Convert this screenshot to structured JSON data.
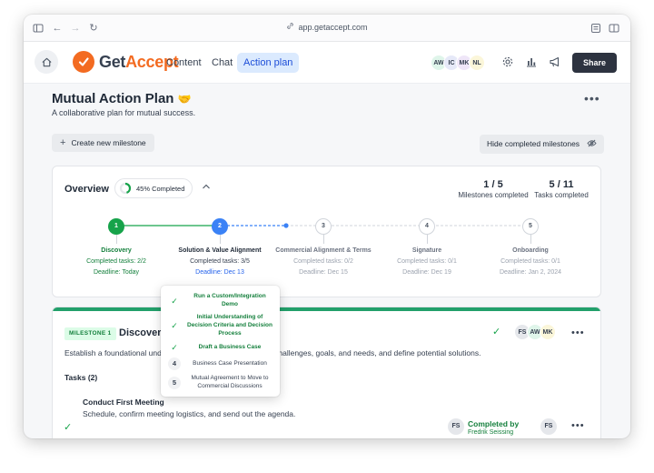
{
  "browser": {
    "url": "app.getaccept.com"
  },
  "app": {
    "logo_prefix": "Get",
    "logo_suffix": "Accept",
    "nav": [
      {
        "label": "Content",
        "active": false
      },
      {
        "label": "Chat",
        "active": false
      },
      {
        "label": "Action plan",
        "active": true
      }
    ],
    "avatars": [
      {
        "initials": "AW",
        "color": "#dff5ea"
      },
      {
        "initials": "IC",
        "color": "#e6e9f8"
      },
      {
        "initials": "MK",
        "color": "#efe6f8"
      },
      {
        "initials": "NL",
        "color": "#fbf6d9"
      }
    ],
    "share_label": "Share"
  },
  "page": {
    "title": "Mutual Action Plan",
    "title_emoji": "🤝",
    "subtitle": "A collaborative plan for mutual success.",
    "new_milestone_label": "Create new milestone",
    "hide_completed_label": "Hide completed milestones"
  },
  "overview": {
    "title": "Overview",
    "progress_label": "45% Completed",
    "progress_fraction": 0.45,
    "milestones_value": "1 / 5",
    "milestones_label": "Milestones completed",
    "tasks_value": "5 / 11",
    "tasks_label": "Tasks completed",
    "steps": [
      {
        "num": "1",
        "name": "Discovery",
        "tasks": "Completed tasks: 2/2",
        "deadline": "Deadline: Today",
        "state": "done"
      },
      {
        "num": "2",
        "name": "Solution & Value Alignment",
        "tasks": "Completed tasks: 3/5",
        "deadline": "Deadline: Dec 13",
        "state": "current"
      },
      {
        "num": "3",
        "name": "Commercial Alignment & Terms",
        "tasks": "Completed tasks: 0/2",
        "deadline": "Deadline: Dec 15",
        "state": "todo"
      },
      {
        "num": "4",
        "name": "Signature",
        "tasks": "Completed tasks: 0/1",
        "deadline": "Deadline: Dec 19",
        "state": "todo"
      },
      {
        "num": "5",
        "name": "Onboarding",
        "tasks": "Completed tasks: 0/1",
        "deadline": "Deadline: Jan 2, 2024",
        "state": "todo"
      }
    ]
  },
  "popover": {
    "items": [
      {
        "mark": "✓",
        "text": "Run a Custom/Integration Demo",
        "state": "done"
      },
      {
        "mark": "✓",
        "text": "Initial Understanding of Decision Criteria and Decision Process",
        "state": "done"
      },
      {
        "mark": "✓",
        "text": "Draft a Business Case",
        "state": "done"
      },
      {
        "mark": "4",
        "text": "Business Case Presentation",
        "state": "todo"
      },
      {
        "mark": "5",
        "text": "Mutual Agreement to Move to Commercial Discussions",
        "state": "todo"
      }
    ]
  },
  "milestone": {
    "tag": "MILESTONE 1",
    "title": "Discovery",
    "desc_start": "Establish a foundational unde",
    "desc_end": "ess challenges, goals, and needs, and define potential solutions.",
    "avatars": [
      {
        "initials": "FS",
        "color": "#e5e7eb"
      },
      {
        "initials": "AW",
        "color": "#dff5ea"
      },
      {
        "initials": "MK",
        "color": "#fbf6d9"
      }
    ],
    "tasks_label": "Tasks (2)",
    "task": {
      "title": "Conduct First Meeting",
      "desc": "Schedule, confirm meeting logistics, and send out the agenda.",
      "completed_label": "Completed by",
      "completed_by": "Fredrik Seissing",
      "avatar": "FS",
      "owner_avatar": "FS"
    }
  },
  "colors": {
    "brand": "#f36b21",
    "done": "#16a34a",
    "current": "#3b82f6",
    "dark_button": "#2d3340"
  }
}
